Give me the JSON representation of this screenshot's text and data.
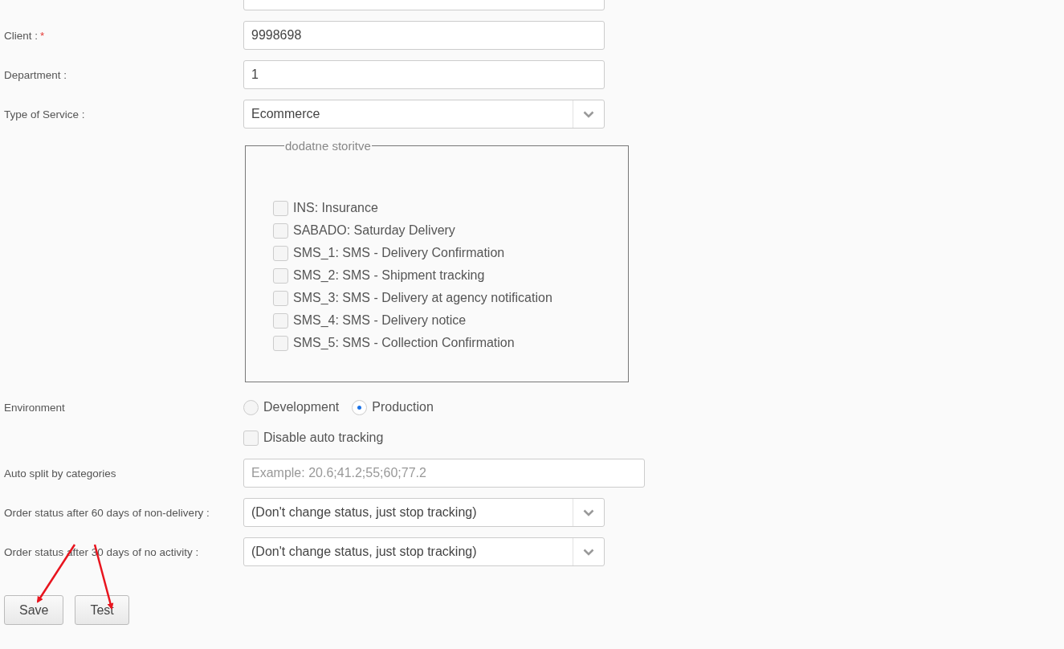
{
  "fields": [
    {
      "kind": "text",
      "label": "Client :",
      "required_mark": "*",
      "value": "9998698"
    },
    {
      "kind": "text",
      "label": "Department :",
      "value": "1"
    },
    {
      "kind": "select",
      "label": "Type of Service :",
      "value": "Ecommerce"
    }
  ],
  "extra_services": {
    "legend": "dodatne storitve",
    "options": [
      {
        "label": "INS: Insurance",
        "checked": false
      },
      {
        "label": "SABADO: Saturday Delivery",
        "checked": false
      },
      {
        "label": "SMS_1: SMS - Delivery Confirmation",
        "checked": false
      },
      {
        "label": "SMS_2: SMS - Shipment tracking",
        "checked": false
      },
      {
        "label": "SMS_3: SMS - Delivery at agency notification",
        "checked": false
      },
      {
        "label": "SMS_4: SMS - Delivery notice",
        "checked": false
      },
      {
        "label": "SMS_5: SMS - Collection Confirmation",
        "checked": false
      }
    ]
  },
  "environment": {
    "label": "Environment",
    "options": [
      {
        "label": "Development",
        "selected": false
      },
      {
        "label": "Production",
        "selected": true
      }
    ]
  },
  "disable_auto_tracking": {
    "label": "Disable auto tracking",
    "checked": false
  },
  "auto_split": {
    "label": "Auto split by categories",
    "placeholder": "Example: 20.6;41.2;55;60;77.2"
  },
  "order_status": [
    {
      "label": "Order status after 60 days of non-delivery :",
      "value": "(Don't change status, just stop tracking)"
    },
    {
      "label": "Order status after 30 days of no activity :",
      "value": "(Don't change status, just stop tracking)"
    }
  ],
  "buttons": [
    "Save",
    "Test"
  ]
}
